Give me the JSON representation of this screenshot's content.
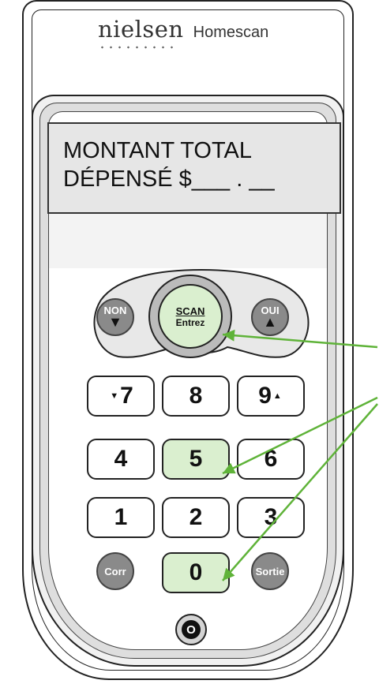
{
  "brand": {
    "name": "nielsen",
    "product": "Homescan"
  },
  "display": {
    "line1": "MONTANT TOTAL",
    "line2": "DÉPENSÉ $___ . __"
  },
  "nav": {
    "non": "NON",
    "oui": "OUI",
    "scan": "SCAN",
    "entrez": "Entrez"
  },
  "keys": {
    "k7": "7",
    "k8": "8",
    "k9": "9",
    "k4": "4",
    "k5": "5",
    "k6": "6",
    "k1": "1",
    "k2": "2",
    "k3": "3",
    "k0": "0",
    "corr": "Corr",
    "sortie": "Sortie"
  },
  "colors": {
    "highlight": "#daefcf",
    "arrow": "#5fb339",
    "round_button": "#8a8a8a"
  },
  "highlighted_keys": [
    "SCAN Entrez",
    "5",
    "0"
  ]
}
